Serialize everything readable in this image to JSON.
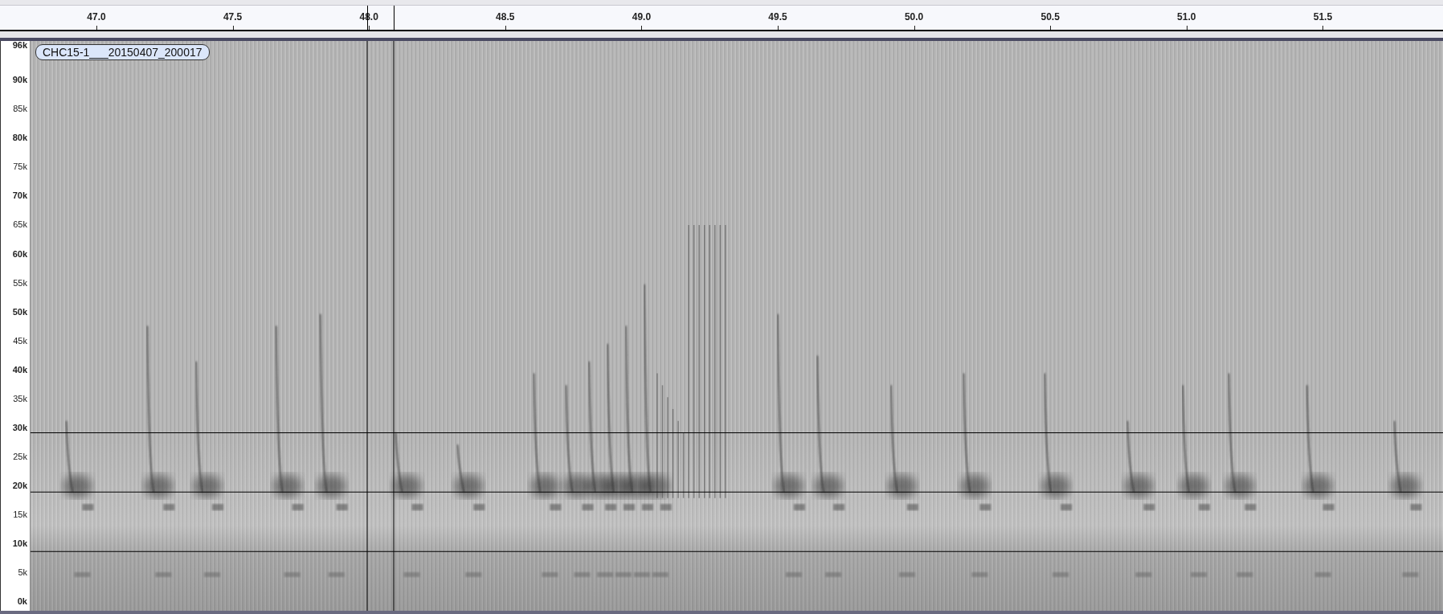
{
  "time_ruler": {
    "ticks": [
      "47.0",
      "47.5",
      "48.0",
      "48.5",
      "49.0",
      "49.5",
      "50.0",
      "50.5",
      "51.0",
      "51.5"
    ]
  },
  "frequency_axis": {
    "labels": [
      {
        "label": "96k",
        "major": true
      },
      {
        "label": "90k",
        "major": true
      },
      {
        "label": "85k",
        "major": false
      },
      {
        "label": "80k",
        "major": true
      },
      {
        "label": "75k",
        "major": false
      },
      {
        "label": "70k",
        "major": true
      },
      {
        "label": "65k",
        "major": false
      },
      {
        "label": "60k",
        "major": true
      },
      {
        "label": "55k",
        "major": false
      },
      {
        "label": "50k",
        "major": true
      },
      {
        "label": "45k",
        "major": false
      },
      {
        "label": "40k",
        "major": true
      },
      {
        "label": "35k",
        "major": false
      },
      {
        "label": "30k",
        "major": true
      },
      {
        "label": "25k",
        "major": false
      },
      {
        "label": "20k",
        "major": true
      },
      {
        "label": "15k",
        "major": false
      },
      {
        "label": "10k",
        "major": true
      },
      {
        "label": "5k",
        "major": false
      },
      {
        "label": "0k",
        "major": true
      }
    ]
  },
  "track": {
    "label": "CHC15-1___20150407_200017"
  }
}
